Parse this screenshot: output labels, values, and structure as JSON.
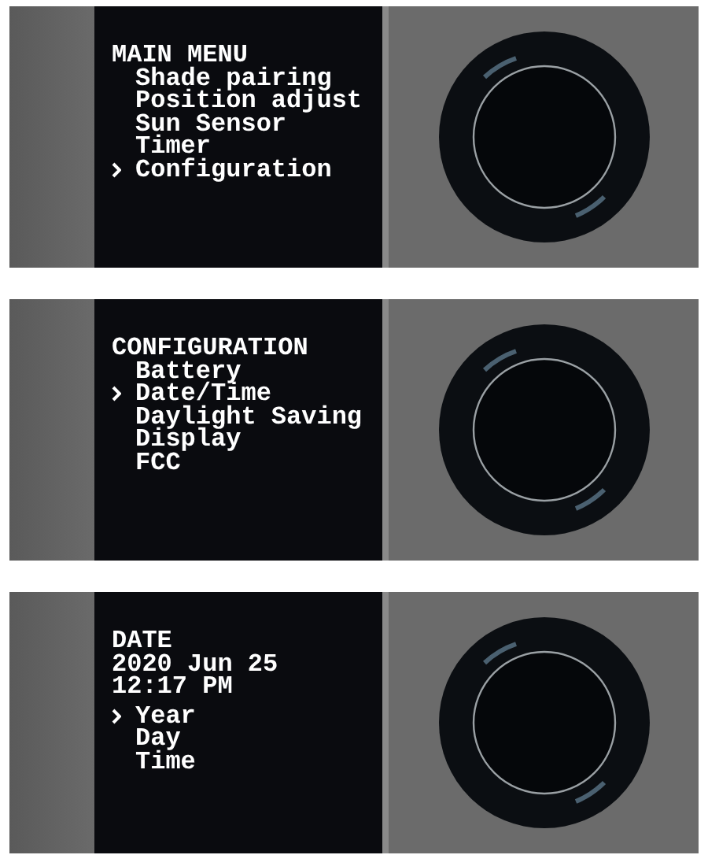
{
  "panels": [
    {
      "title": "MAIN MENU",
      "items": [
        {
          "label": "Shade pairing",
          "selected": false
        },
        {
          "label": "Position adjust",
          "selected": false
        },
        {
          "label": "Sun Sensor",
          "selected": false
        },
        {
          "label": "Timer",
          "selected": false
        },
        {
          "label": "Configuration",
          "selected": true
        }
      ]
    },
    {
      "title": "CONFIGURATION",
      "items": [
        {
          "label": "Battery",
          "selected": false
        },
        {
          "label": "Date/Time",
          "selected": true
        },
        {
          "label": "Daylight Saving",
          "selected": false
        },
        {
          "label": "Display",
          "selected": false
        },
        {
          "label": "FCC",
          "selected": false
        }
      ]
    },
    {
      "title": "DATE",
      "lines": [
        "2020 Jun 25",
        "12:17 PM"
      ],
      "items": [
        {
          "label": "Year",
          "selected": true
        },
        {
          "label": "Day",
          "selected": false
        },
        {
          "label": "Time",
          "selected": false
        }
      ]
    }
  ]
}
